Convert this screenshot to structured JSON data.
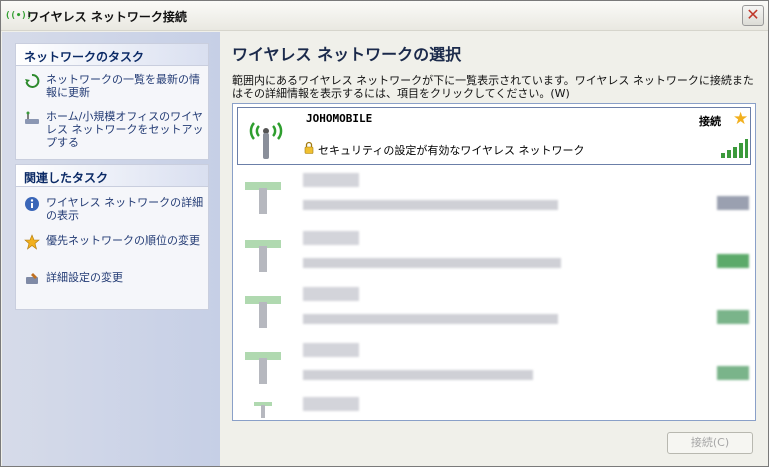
{
  "window": {
    "title": "ワイヤレス ネットワーク接続",
    "title_icon": "((•))",
    "close_label": "✕"
  },
  "sidebar": {
    "network_tasks": {
      "heading": "ネットワークのタスク",
      "items": [
        {
          "label": "ネットワークの一覧を最新の情報に更新",
          "icon": "refresh-icon"
        },
        {
          "label": "ホーム/小規模オフィスのワイヤレス ネットワークをセットアップする",
          "icon": "setup-icon"
        }
      ]
    },
    "related_tasks": {
      "heading": "関連したタスク",
      "items": [
        {
          "label": "ワイヤレス ネットワークの詳細の表示",
          "icon": "info-icon"
        },
        {
          "label": "優先ネットワークの順位の変更",
          "icon": "star-icon"
        },
        {
          "label": "詳細設定の変更",
          "icon": "settings-icon"
        }
      ]
    }
  },
  "main": {
    "title": "ワイヤレス ネットワークの選択",
    "description": "範囲内にあるワイヤレス ネットワークが下に一覧表示されています。ワイヤレス ネットワークに接続またはその詳細情報を表示するには、項目をクリックしてください。(W)",
    "selected_network": {
      "ssid": "JOHOMOBILE",
      "status": "接続",
      "security": "セキュリティの設定が有効なワイヤレス ネットワーク",
      "signal_bars": 5,
      "signal_strength_fraction": 1.0
    }
  },
  "buttons": {
    "connect": "接続(C)"
  },
  "colors": {
    "accent": "#0b2a66",
    "link": "#243c75",
    "signal_green": "#3b9a3b",
    "star": "#f2b01e"
  }
}
